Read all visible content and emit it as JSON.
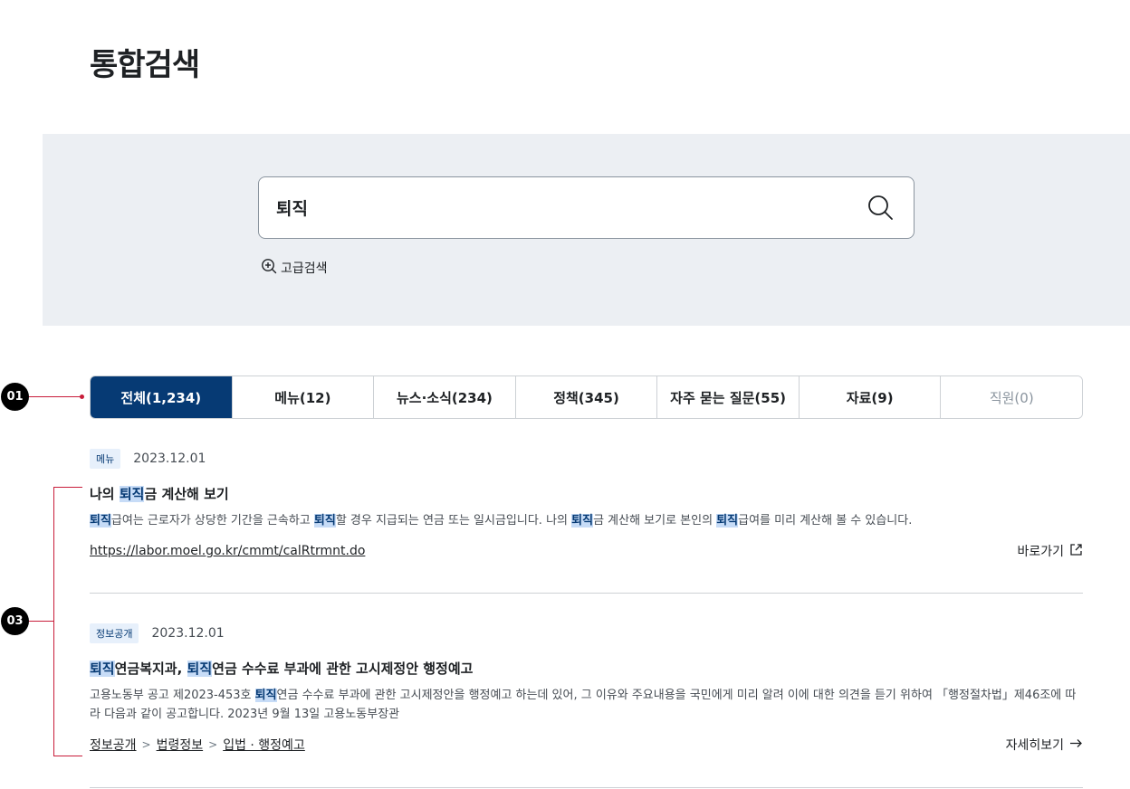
{
  "page": {
    "title": "통합검색"
  },
  "search": {
    "value": "퇴직",
    "advanced_label": "고급검색"
  },
  "tabs": [
    {
      "label": "전체(1,234)",
      "active": true
    },
    {
      "label": "메뉴(12)"
    },
    {
      "label": "뉴스·소식(234)"
    },
    {
      "label": "정책(345)"
    },
    {
      "label": "자주 묻는 질문(55)"
    },
    {
      "label": "자료(9)"
    },
    {
      "label": "직원(0)",
      "disabled": true
    }
  ],
  "markers": {
    "m1": "01",
    "m2": "03"
  },
  "highlight": "퇴직",
  "results": [
    {
      "badge": "메뉴",
      "date": "2023.12.01",
      "title_parts": [
        "나의 ",
        "금 계산해 보기"
      ],
      "desc_parts": [
        "급여는 근로자가 상당한 기간을 근속하고 ",
        "할 경우 지급되는 연금 또는 일시금입니다. 나의 ",
        "금 계산해 보기로 본인의 ",
        "급여를 미리 계산해 볼 수 있습니다."
      ],
      "url": "https://labor.moel.go.kr/cmmt/calRtrmnt.do",
      "action": "바로가기"
    },
    {
      "badge": "정보공개",
      "date": "2023.12.01",
      "title_parts": [
        "연금복지과, ",
        "연금 수수료 부과에 관한 고시제정안 행정예고"
      ],
      "desc_parts": [
        "고용노동부 공고 제2023-453호 ",
        "연금 수수료 부과에 관한 고시제정안을 행정예고 하는데 있어, 그 이유와 주요내용을 국민에게 미리 알려 이에 대한 의견을 듣기 위하여 「행정절차법」제46조에 따라 다음과 같이 공고합니다. 2023년 9월 13일 고용노동부장관"
      ],
      "breadcrumb": [
        "정보공개",
        "법령정보",
        "입법 · 행정예고"
      ],
      "action": "자세히보기"
    }
  ]
}
